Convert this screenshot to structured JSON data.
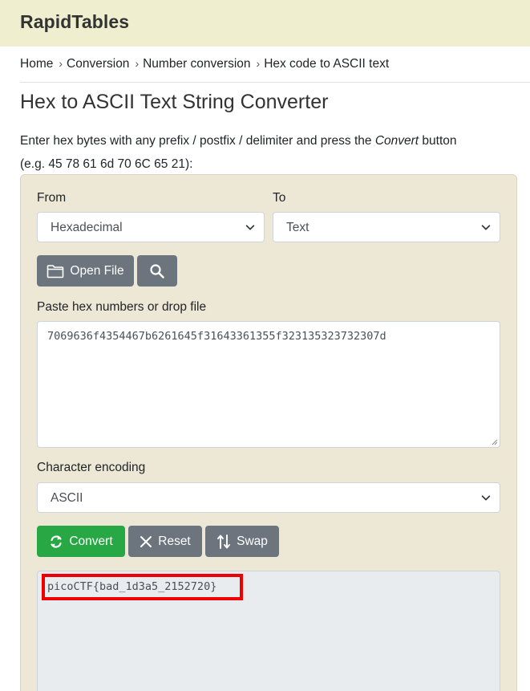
{
  "header": {
    "logo": "RapidTables"
  },
  "breadcrumb": {
    "items": [
      "Home",
      "Conversion",
      "Number conversion",
      "Hex code to ASCII text"
    ],
    "separator": "›"
  },
  "page": {
    "title": "Hex to ASCII Text String Converter",
    "intro_before": "Enter hex bytes with any prefix / postfix / delimiter and press the ",
    "intro_em": "Convert",
    "intro_after": " button",
    "intro_example": "(e.g. 45 78 61 6d 70 6C 65 21):"
  },
  "converter": {
    "from_label": "From",
    "from_value": "Hexadecimal",
    "to_label": "To",
    "to_value": "Text",
    "open_file_label": "Open File",
    "input_label": "Paste hex numbers or drop file",
    "input_value": "7069636f4354467b6261645f31643361355f323135323732307d",
    "encoding_label": "Character encoding",
    "encoding_value": "ASCII",
    "convert_label": "Convert",
    "reset_label": "Reset",
    "swap_label": "Swap",
    "output_value": "picoCTF{bad_1d3a5_2152720}"
  },
  "icons": {
    "folder": "folder-icon",
    "search": "search-icon",
    "convert": "refresh-icon",
    "reset": "close-icon",
    "swap": "swap-icon",
    "dropdown": "chevron-down-icon"
  },
  "colors": {
    "header_bg": "#efefd0",
    "panel_bg": "#ede7d5",
    "gray_button": "#6c757d",
    "green_button": "#28a745",
    "highlight": "#ee0000"
  }
}
